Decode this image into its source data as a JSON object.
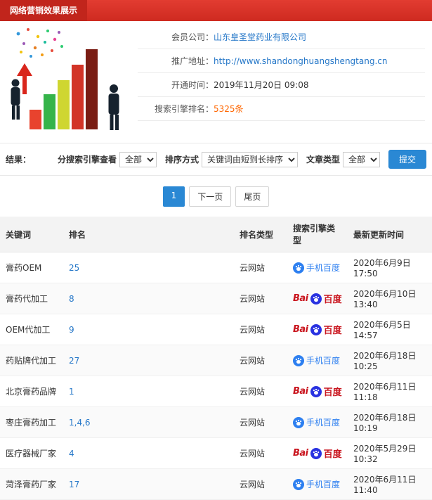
{
  "header": {
    "title": "网络营销效果展示"
  },
  "info": {
    "member_label": "会员公司：",
    "member_value": "山东皇圣堂药业有限公司",
    "url_label": "推广地址：",
    "url_value": "http://www.shandonghuangshengtang.cn",
    "open_label": "开通时间：",
    "open_value": "2019年11月20日 09:08",
    "rank_label": "搜索引擎排名：",
    "rank_value": "5325条"
  },
  "filters": {
    "result_label": "结果：",
    "engine_label": "分搜索引擎查看",
    "engine_value": "全部",
    "sort_label": "排序方式",
    "sort_value": "关键词由短到长排序",
    "article_label": "文章类型",
    "article_value": "全部",
    "submit_label": "提交"
  },
  "pagination": {
    "current": "1",
    "next": "下一页",
    "last": "尾页"
  },
  "engines": {
    "baidu": {
      "latin": "Bai",
      "cn": "百度"
    },
    "mobile": {
      "label": "手机百度"
    }
  },
  "table": {
    "headers": [
      "关键词",
      "排名",
      "排名类型",
      "搜索引擎类型",
      "最新更新时间"
    ],
    "rows": [
      {
        "keyword": "膏药OEM",
        "rank": "25",
        "rank_type": "云网站",
        "engine": "mobile",
        "updated": "2020年6月9日 17:50"
      },
      {
        "keyword": "膏药代加工",
        "rank": "8",
        "rank_type": "云网站",
        "engine": "baidu",
        "updated": "2020年6月10日 13:40"
      },
      {
        "keyword": "OEM代加工",
        "rank": "9",
        "rank_type": "云网站",
        "engine": "baidu",
        "updated": "2020年6月5日 14:57"
      },
      {
        "keyword": "药贴牌代加工",
        "rank": "27",
        "rank_type": "云网站",
        "engine": "mobile",
        "updated": "2020年6月18日 10:25"
      },
      {
        "keyword": "北京膏药品牌",
        "rank": "1",
        "rank_type": "云网站",
        "engine": "baidu",
        "updated": "2020年6月11日 11:18"
      },
      {
        "keyword": "枣庄膏药加工",
        "rank": "1,4,6",
        "rank_type": "云网站",
        "engine": "mobile",
        "updated": "2020年6月18日 10:19"
      },
      {
        "keyword": "医疗器械厂家",
        "rank": "4",
        "rank_type": "云网站",
        "engine": "baidu",
        "updated": "2020年5月29日 10:32"
      },
      {
        "keyword": "菏泽膏药厂家",
        "rank": "17",
        "rank_type": "云网站",
        "engine": "mobile",
        "updated": "2020年6月11日 11:40"
      }
    ]
  }
}
